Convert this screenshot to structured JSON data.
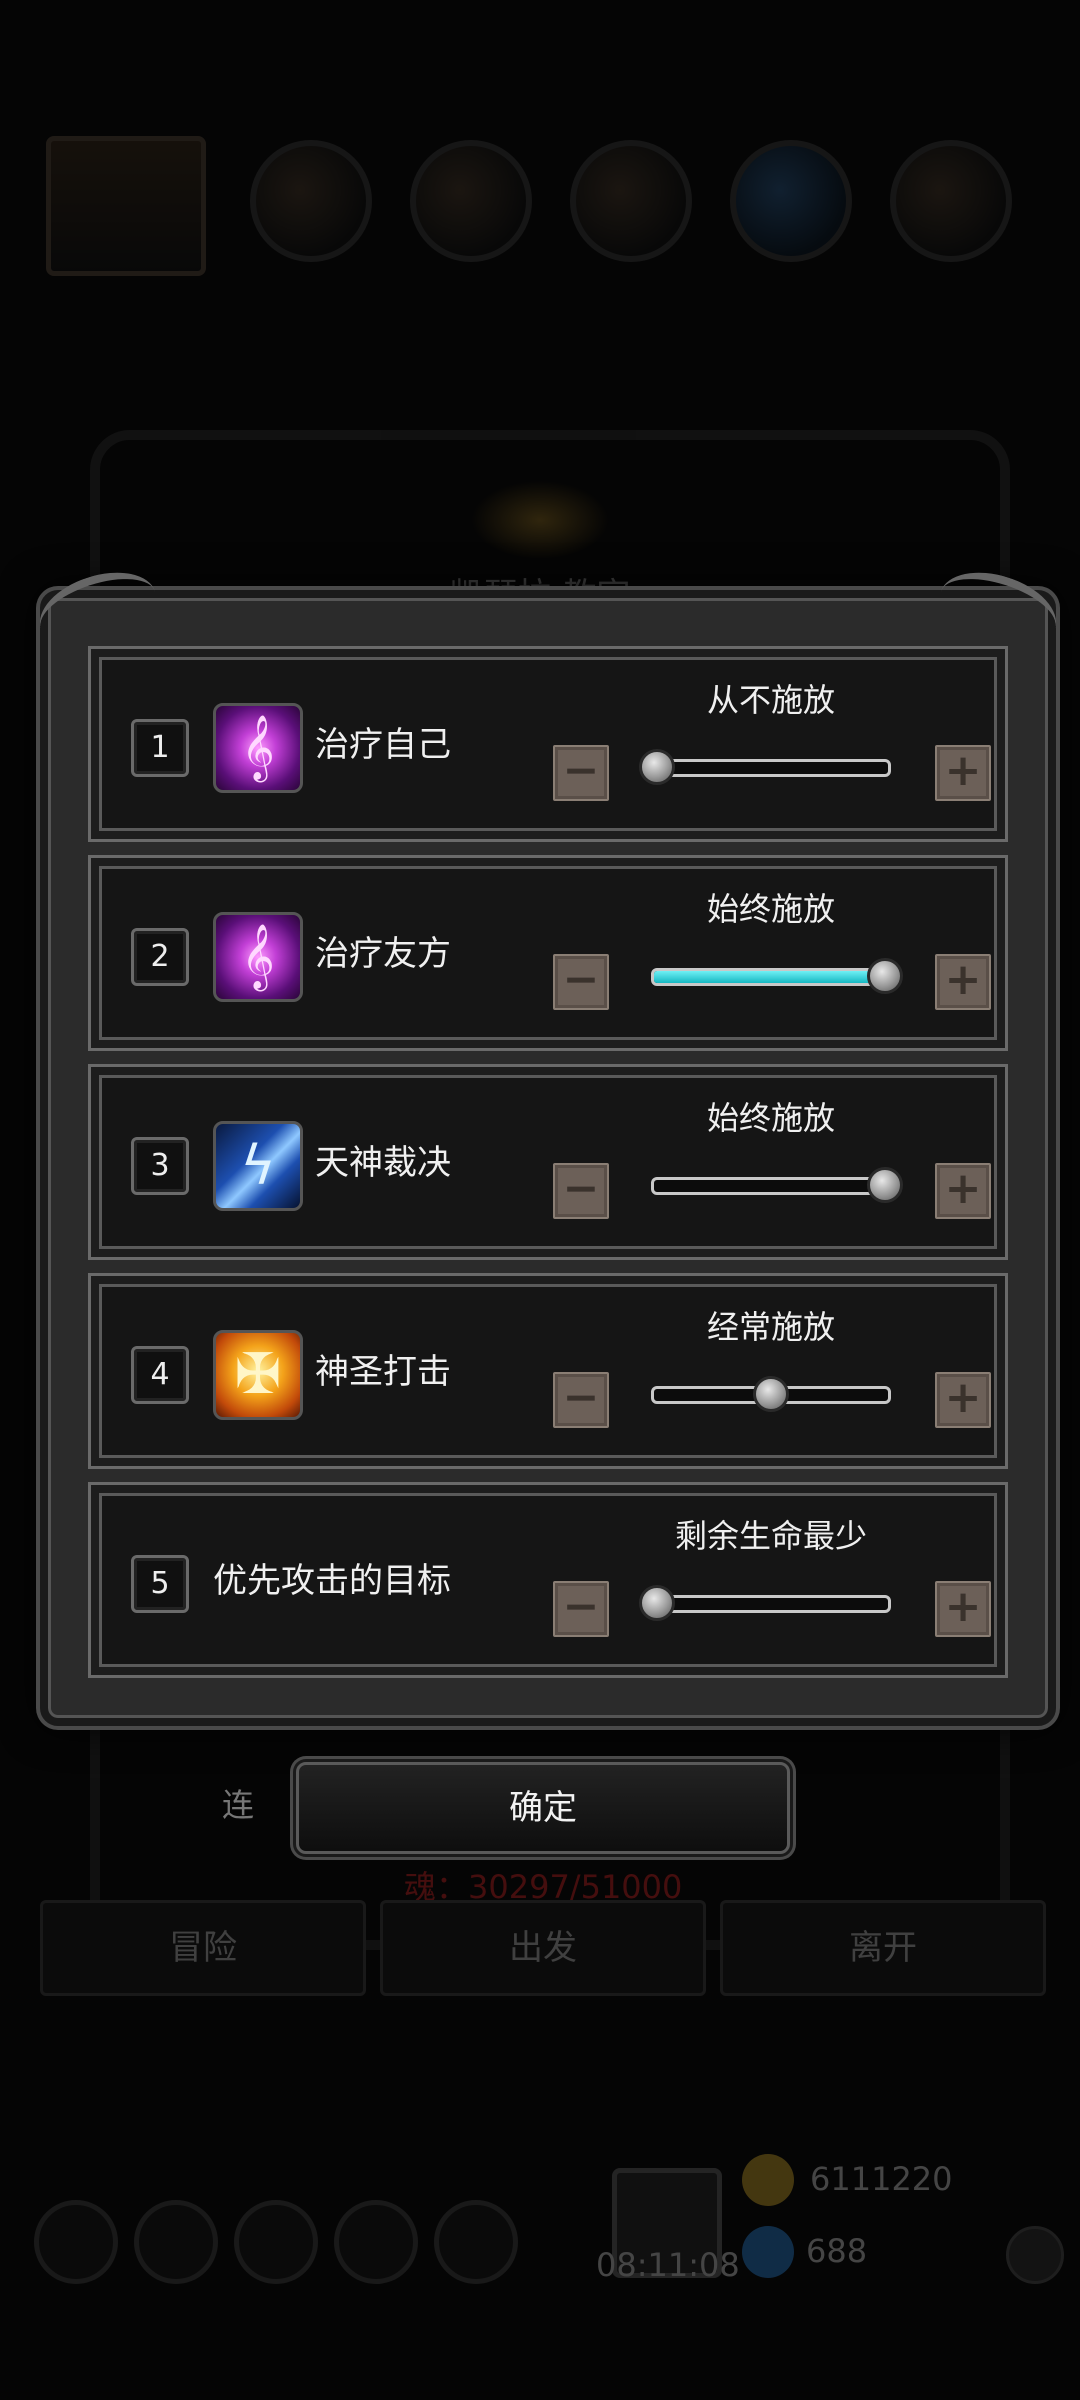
{
  "background": {
    "title": "凯瑟拉 教宗",
    "soul_text": "魂：30297/51000",
    "buttons": [
      "冒险",
      "出发",
      "离开"
    ],
    "timer": "08:11:08",
    "gold": "6111220",
    "gems": "688",
    "side_label": "连"
  },
  "rows": [
    {
      "num": "1",
      "name": "治疗自己",
      "icon": "heal-icon",
      "glyph": "𝄞",
      "level": "从不施放",
      "value": 0.0
    },
    {
      "num": "2",
      "name": "治疗友方",
      "icon": "heal-icon",
      "glyph": "𝄞",
      "level": "始终施放",
      "value": 1.0
    },
    {
      "num": "3",
      "name": "天神裁决",
      "icon": "lightning-icon",
      "glyph": "ϟ",
      "level": "始终施放",
      "value": 1.0
    },
    {
      "num": "4",
      "name": "神圣打击",
      "icon": "holy-strike-icon",
      "glyph": "✠",
      "level": "经常施放",
      "value": 0.5
    },
    {
      "num": "5",
      "name": "优先攻击的目标",
      "icon": "",
      "glyph": "",
      "level": "剩余生命最少",
      "value": 0.0
    }
  ],
  "controls": {
    "minus": "−",
    "plus": "+"
  },
  "confirm_label": "确定",
  "colors": {
    "slider_fill": "#16b8c2",
    "step_button": "#6c6058"
  }
}
